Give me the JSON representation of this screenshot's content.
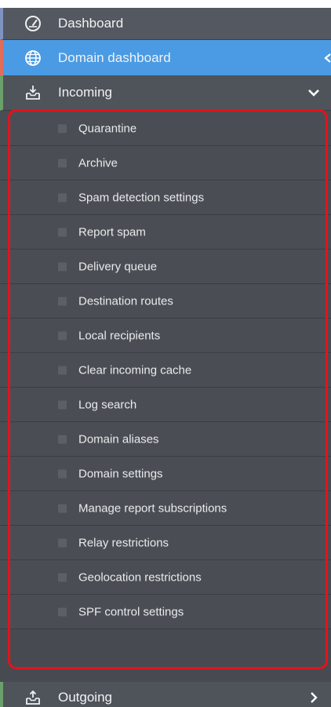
{
  "nav": {
    "dashboard": {
      "label": "Dashboard",
      "icon": "speedometer-icon"
    },
    "domain_dashboard": {
      "label": "Domain dashboard",
      "icon": "globe-icon"
    },
    "incoming": {
      "label": "Incoming",
      "icon": "inbox-download-icon",
      "items": [
        {
          "label": "Quarantine"
        },
        {
          "label": "Archive"
        },
        {
          "label": "Spam detection settings"
        },
        {
          "label": "Report spam"
        },
        {
          "label": "Delivery queue"
        },
        {
          "label": "Destination routes"
        },
        {
          "label": "Local recipients"
        },
        {
          "label": "Clear incoming cache"
        },
        {
          "label": "Log search"
        },
        {
          "label": "Domain aliases"
        },
        {
          "label": "Domain settings"
        },
        {
          "label": "Manage report subscriptions"
        },
        {
          "label": "Relay restrictions"
        },
        {
          "label": "Geolocation restrictions"
        },
        {
          "label": "SPF control settings"
        }
      ]
    },
    "outgoing": {
      "label": "Outgoing",
      "icon": "outbox-upload-icon"
    }
  },
  "colors": {
    "sidebar_bg": "#474b51",
    "active_bg": "#4a9be4",
    "highlight_border": "#e4121b"
  }
}
